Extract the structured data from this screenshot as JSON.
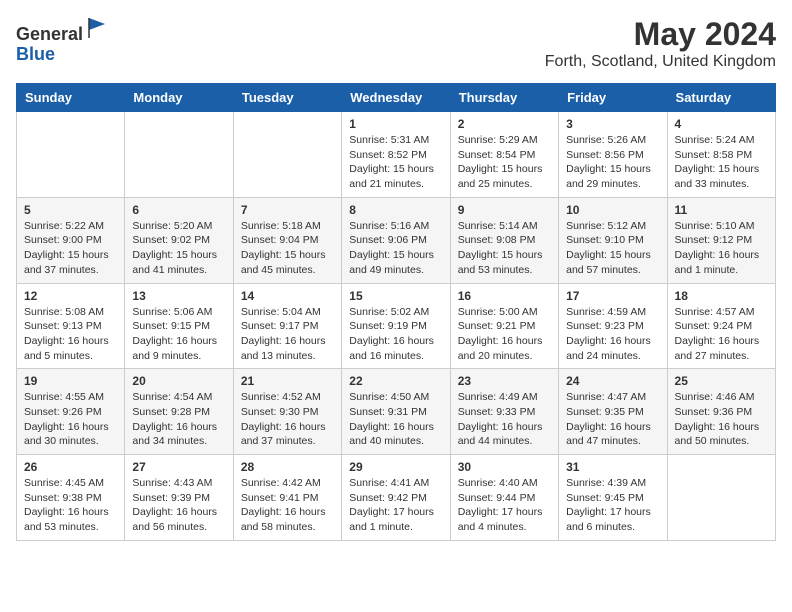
{
  "header": {
    "logo": {
      "line1": "General",
      "line2": "Blue"
    },
    "title": "May 2024",
    "location": "Forth, Scotland, United Kingdom"
  },
  "calendar": {
    "days_of_week": [
      "Sunday",
      "Monday",
      "Tuesday",
      "Wednesday",
      "Thursday",
      "Friday",
      "Saturday"
    ],
    "weeks": [
      [
        {
          "day": "",
          "info": ""
        },
        {
          "day": "",
          "info": ""
        },
        {
          "day": "",
          "info": ""
        },
        {
          "day": "1",
          "info": "Sunrise: 5:31 AM\nSunset: 8:52 PM\nDaylight: 15 hours\nand 21 minutes."
        },
        {
          "day": "2",
          "info": "Sunrise: 5:29 AM\nSunset: 8:54 PM\nDaylight: 15 hours\nand 25 minutes."
        },
        {
          "day": "3",
          "info": "Sunrise: 5:26 AM\nSunset: 8:56 PM\nDaylight: 15 hours\nand 29 minutes."
        },
        {
          "day": "4",
          "info": "Sunrise: 5:24 AM\nSunset: 8:58 PM\nDaylight: 15 hours\nand 33 minutes."
        }
      ],
      [
        {
          "day": "5",
          "info": "Sunrise: 5:22 AM\nSunset: 9:00 PM\nDaylight: 15 hours\nand 37 minutes."
        },
        {
          "day": "6",
          "info": "Sunrise: 5:20 AM\nSunset: 9:02 PM\nDaylight: 15 hours\nand 41 minutes."
        },
        {
          "day": "7",
          "info": "Sunrise: 5:18 AM\nSunset: 9:04 PM\nDaylight: 15 hours\nand 45 minutes."
        },
        {
          "day": "8",
          "info": "Sunrise: 5:16 AM\nSunset: 9:06 PM\nDaylight: 15 hours\nand 49 minutes."
        },
        {
          "day": "9",
          "info": "Sunrise: 5:14 AM\nSunset: 9:08 PM\nDaylight: 15 hours\nand 53 minutes."
        },
        {
          "day": "10",
          "info": "Sunrise: 5:12 AM\nSunset: 9:10 PM\nDaylight: 15 hours\nand 57 minutes."
        },
        {
          "day": "11",
          "info": "Sunrise: 5:10 AM\nSunset: 9:12 PM\nDaylight: 16 hours\nand 1 minute."
        }
      ],
      [
        {
          "day": "12",
          "info": "Sunrise: 5:08 AM\nSunset: 9:13 PM\nDaylight: 16 hours\nand 5 minutes."
        },
        {
          "day": "13",
          "info": "Sunrise: 5:06 AM\nSunset: 9:15 PM\nDaylight: 16 hours\nand 9 minutes."
        },
        {
          "day": "14",
          "info": "Sunrise: 5:04 AM\nSunset: 9:17 PM\nDaylight: 16 hours\nand 13 minutes."
        },
        {
          "day": "15",
          "info": "Sunrise: 5:02 AM\nSunset: 9:19 PM\nDaylight: 16 hours\nand 16 minutes."
        },
        {
          "day": "16",
          "info": "Sunrise: 5:00 AM\nSunset: 9:21 PM\nDaylight: 16 hours\nand 20 minutes."
        },
        {
          "day": "17",
          "info": "Sunrise: 4:59 AM\nSunset: 9:23 PM\nDaylight: 16 hours\nand 24 minutes."
        },
        {
          "day": "18",
          "info": "Sunrise: 4:57 AM\nSunset: 9:24 PM\nDaylight: 16 hours\nand 27 minutes."
        }
      ],
      [
        {
          "day": "19",
          "info": "Sunrise: 4:55 AM\nSunset: 9:26 PM\nDaylight: 16 hours\nand 30 minutes."
        },
        {
          "day": "20",
          "info": "Sunrise: 4:54 AM\nSunset: 9:28 PM\nDaylight: 16 hours\nand 34 minutes."
        },
        {
          "day": "21",
          "info": "Sunrise: 4:52 AM\nSunset: 9:30 PM\nDaylight: 16 hours\nand 37 minutes."
        },
        {
          "day": "22",
          "info": "Sunrise: 4:50 AM\nSunset: 9:31 PM\nDaylight: 16 hours\nand 40 minutes."
        },
        {
          "day": "23",
          "info": "Sunrise: 4:49 AM\nSunset: 9:33 PM\nDaylight: 16 hours\nand 44 minutes."
        },
        {
          "day": "24",
          "info": "Sunrise: 4:47 AM\nSunset: 9:35 PM\nDaylight: 16 hours\nand 47 minutes."
        },
        {
          "day": "25",
          "info": "Sunrise: 4:46 AM\nSunset: 9:36 PM\nDaylight: 16 hours\nand 50 minutes."
        }
      ],
      [
        {
          "day": "26",
          "info": "Sunrise: 4:45 AM\nSunset: 9:38 PM\nDaylight: 16 hours\nand 53 minutes."
        },
        {
          "day": "27",
          "info": "Sunrise: 4:43 AM\nSunset: 9:39 PM\nDaylight: 16 hours\nand 56 minutes."
        },
        {
          "day": "28",
          "info": "Sunrise: 4:42 AM\nSunset: 9:41 PM\nDaylight: 16 hours\nand 58 minutes."
        },
        {
          "day": "29",
          "info": "Sunrise: 4:41 AM\nSunset: 9:42 PM\nDaylight: 17 hours\nand 1 minute."
        },
        {
          "day": "30",
          "info": "Sunrise: 4:40 AM\nSunset: 9:44 PM\nDaylight: 17 hours\nand 4 minutes."
        },
        {
          "day": "31",
          "info": "Sunrise: 4:39 AM\nSunset: 9:45 PM\nDaylight: 17 hours\nand 6 minutes."
        },
        {
          "day": "",
          "info": ""
        }
      ]
    ]
  }
}
